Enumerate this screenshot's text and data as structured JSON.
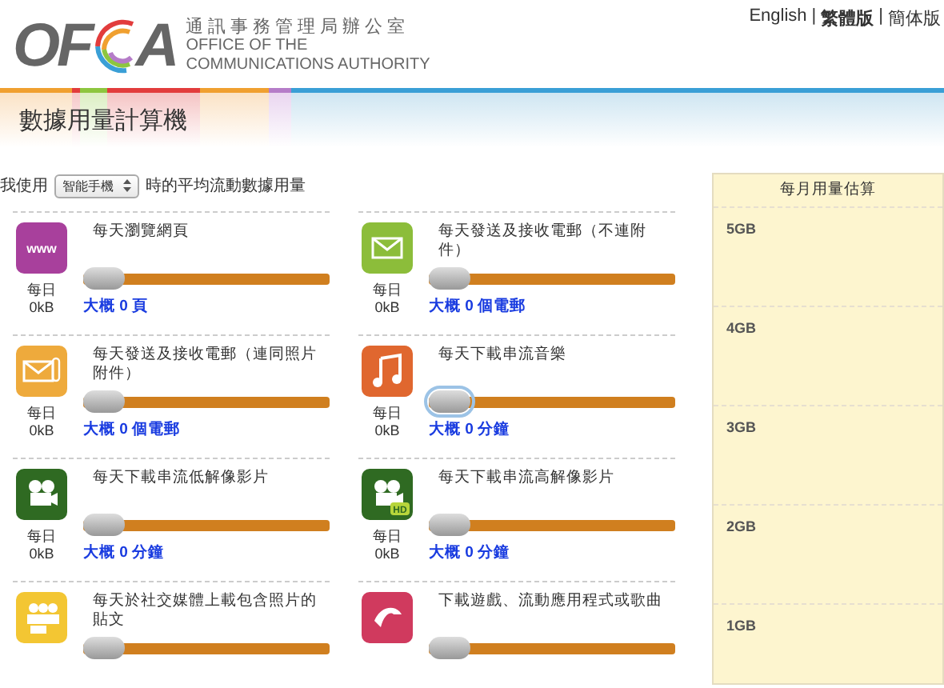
{
  "header": {
    "logo": {
      "left": "OF",
      "right": "A"
    },
    "org_zh": "通訊事務管理局辦公室",
    "org_en_1": "OFFICE OF THE",
    "org_en_2": "COMMUNICATIONS AUTHORITY",
    "separator": "|",
    "languages": [
      {
        "label": "English",
        "selected": false
      },
      {
        "label": "繁體版",
        "selected": true
      },
      {
        "label": "簡体版",
        "selected": false
      }
    ]
  },
  "page_title": "數據用量計算機",
  "selector": {
    "prefix": "我使用",
    "value": "智能手機",
    "suffix": "時的平均流動數據用量"
  },
  "activities": [
    {
      "kind": "www",
      "icon_text": "www",
      "title": "每天瀏覽網頁",
      "daily": "每日",
      "usage": "0kB",
      "level": 0,
      "focused": false,
      "estimate": "大概 0 頁"
    },
    {
      "kind": "mail",
      "title": "每天發送及接收電郵（不連附件）",
      "daily": "每日",
      "usage": "0kB",
      "level": 0,
      "focused": false,
      "estimate": "大概 0 個電郵"
    },
    {
      "kind": "mail-attach",
      "title": "每天發送及接收電郵（連同照片附件）",
      "daily": "每日",
      "usage": "0kB",
      "level": 0,
      "focused": false,
      "estimate": "大概 0 個電郵"
    },
    {
      "kind": "music",
      "title": "每天下載串流音樂",
      "daily": "每日",
      "usage": "0kB",
      "level": 0,
      "focused": true,
      "estimate": "大概 0 分鐘"
    },
    {
      "kind": "film",
      "title": "每天下載串流低解像影片",
      "daily": "每日",
      "usage": "0kB",
      "level": 0,
      "focused": false,
      "estimate": "大概 0 分鐘"
    },
    {
      "kind": "film-hd",
      "icon_text": "HD",
      "title": "每天下載串流高解像影片",
      "daily": "每日",
      "usage": "0kB",
      "level": 0,
      "focused": false,
      "estimate": "大概 0 分鐘"
    },
    {
      "kind": "people",
      "title": "每天於社交媒體上載包含照片的貼文",
      "level": 0,
      "focused": false
    },
    {
      "kind": "app",
      "title": "下載遊戲、流動應用程式或歌曲",
      "level": 0,
      "focused": false
    }
  ],
  "monthly": {
    "title": "每月用量估算",
    "levels": [
      "5GB",
      "4GB",
      "3GB",
      "2GB",
      "1GB"
    ]
  }
}
